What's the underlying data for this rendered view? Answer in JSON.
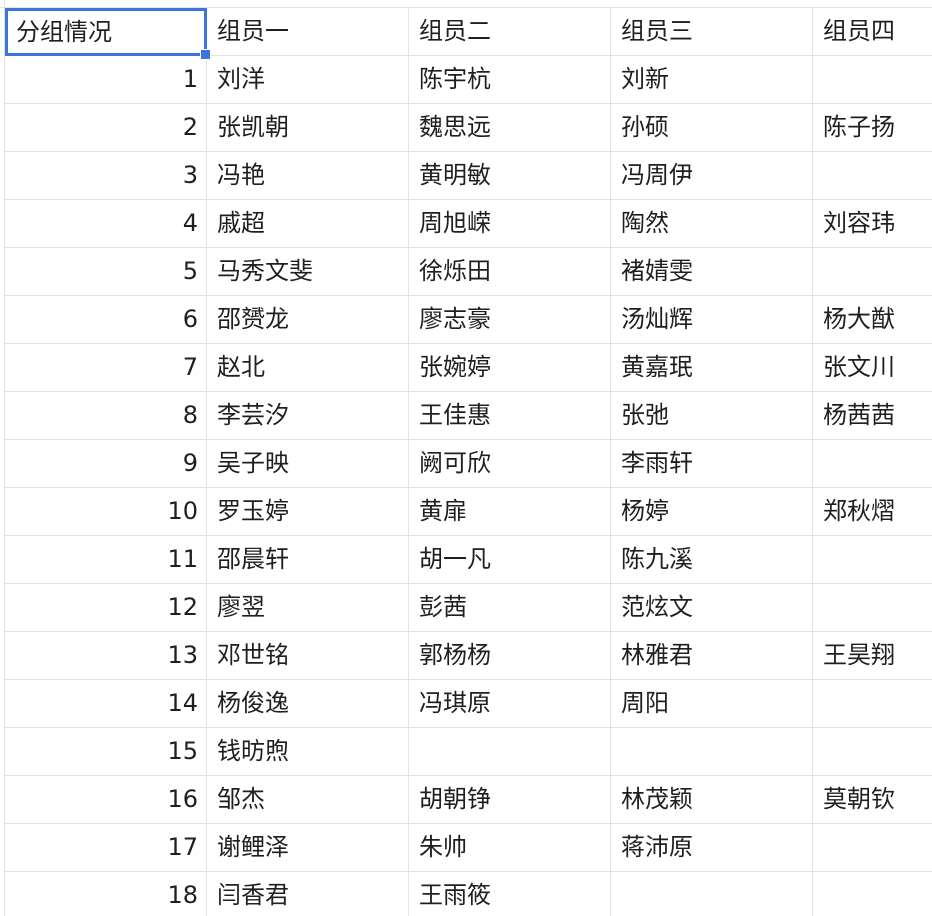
{
  "sheet": {
    "headers": [
      "分组情况",
      "组员一",
      "组员二",
      "组员三",
      "组员四"
    ],
    "rows": [
      [
        "1",
        "刘洋",
        "陈宇杭",
        "刘新",
        ""
      ],
      [
        "2",
        "张凯朝",
        "魏思远",
        "孙硕",
        "陈子扬"
      ],
      [
        "3",
        "冯艳",
        "黄明敏",
        "冯周伊",
        ""
      ],
      [
        "4",
        "戚超",
        "周旭嵘",
        "陶然",
        "刘容玮"
      ],
      [
        "5",
        "马秀文斐",
        "徐烁田",
        "褚婧雯",
        ""
      ],
      [
        "6",
        "邵赟龙",
        "廖志豪",
        "汤灿辉",
        "杨大猷"
      ],
      [
        "7",
        "赵北",
        "张婉婷",
        "黄嘉珉",
        "张文川"
      ],
      [
        "8",
        "李芸汐",
        "王佳惠",
        "张弛",
        "杨茜茜"
      ],
      [
        "9",
        "吴子映",
        "阙可欣",
        "李雨轩",
        ""
      ],
      [
        "10",
        "罗玉婷",
        "黄扉",
        "杨婷",
        "郑秋熠"
      ],
      [
        "11",
        "邵晨轩",
        "胡一凡",
        "陈九溪",
        ""
      ],
      [
        "12",
        "廖翌",
        "彭茜",
        "范炫文",
        ""
      ],
      [
        "13",
        "邓世铭",
        "郭杨杨",
        "林雅君",
        "王昊翔"
      ],
      [
        "14",
        "杨俊逸",
        "冯琪原",
        "周阳",
        ""
      ],
      [
        "15",
        "钱昉煦",
        "",
        "",
        ""
      ],
      [
        "16",
        "邹杰",
        "胡朝铮",
        "林茂颖",
        "莫朝钦"
      ],
      [
        "17",
        "谢鲤泽",
        "朱帅",
        "蒋沛原",
        ""
      ],
      [
        "18",
        "闫香君",
        "王雨筱",
        "",
        ""
      ]
    ],
    "accent_color": "#3b73e0",
    "gridline_color": "#e2e2e2"
  }
}
